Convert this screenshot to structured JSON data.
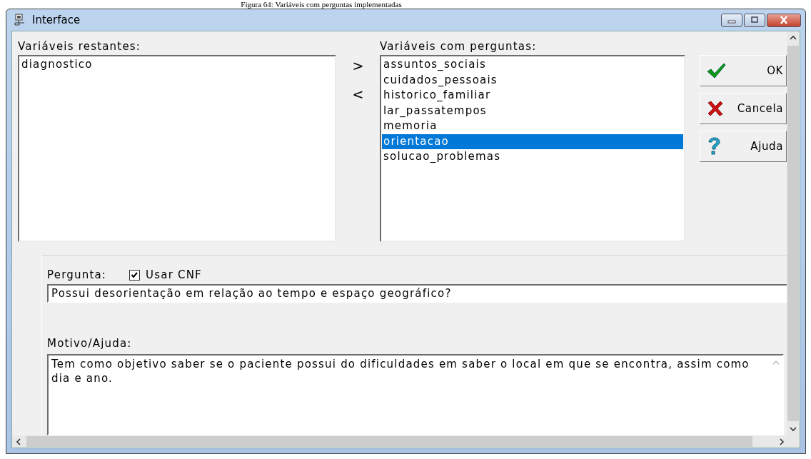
{
  "caption": "Figura 64: Variáveis com perguntas implementadas",
  "window": {
    "title": "Interface"
  },
  "available": {
    "label": "Variáveis restantes:",
    "items": [
      {
        "text": "diagnostico",
        "selected": false
      }
    ]
  },
  "move_buttons": [
    ">",
    "<"
  ],
  "questions": {
    "label": "Variáveis com perguntas:",
    "items": [
      {
        "text": "assuntos_sociais",
        "selected": false
      },
      {
        "text": "cuidados_pessoais",
        "selected": false
      },
      {
        "text": "historico_familiar",
        "selected": false
      },
      {
        "text": "lar_passatempos",
        "selected": false
      },
      {
        "text": "memoria",
        "selected": false
      },
      {
        "text": "orientacao",
        "selected": true
      },
      {
        "text": "solucao_problemas",
        "selected": false
      }
    ]
  },
  "buttons": [
    {
      "kind": "ok",
      "label": "OK"
    },
    {
      "kind": "cancel",
      "label": "Cancela"
    },
    {
      "kind": "help",
      "label": "Ajuda"
    }
  ],
  "question": {
    "label": "Pergunta:",
    "use_cnf": {
      "label": "Usar CNF",
      "checked": true
    },
    "value": "Possui desorientação em relação ao tempo e espaço geográfico?"
  },
  "reason": {
    "label": "Motivo/Ajuda:",
    "value": "Tem como objetivo saber se o paciente possui do dificuldades em saber o local em que se encontra, assim como dia e ano."
  }
}
